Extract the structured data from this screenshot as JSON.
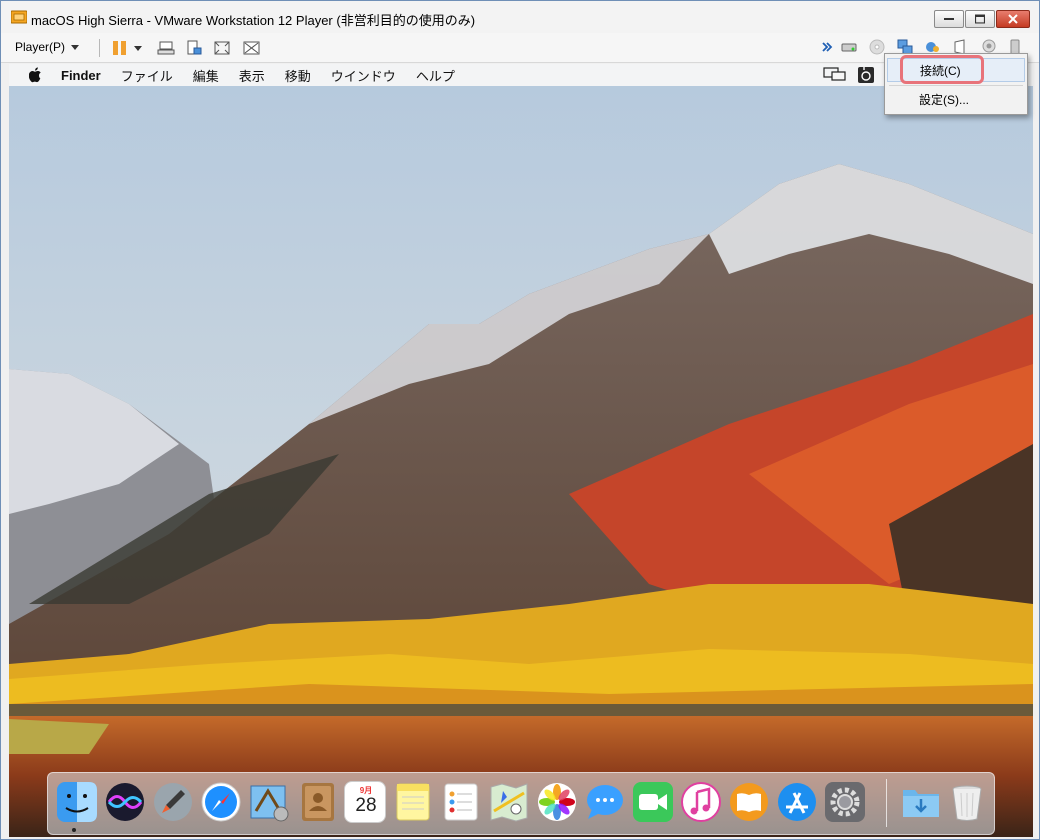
{
  "window": {
    "title": "macOS High Sierra - VMware Workstation 12 Player (非営利目的の使用のみ)",
    "controls": [
      "minimize-icon",
      "maximize-icon",
      "close-icon"
    ]
  },
  "toolbar": {
    "player_menu_label": "Player(P)",
    "icons": [
      "pause-icon",
      "chevron-down-icon",
      "send-ctrl-alt-del-icon",
      "removable-devices-icon",
      "fit-window-icon",
      "unity-icon"
    ],
    "tray_icons": [
      "double-chevron-icon",
      "hard-disk-icon",
      "cd-dvd-icon",
      "network-adapter-icon",
      "usb-controller-icon",
      "sound-card-icon",
      "printer-icon",
      "camera-icon",
      "usb-drive-icon"
    ]
  },
  "guest_menubar": {
    "apple_icon": "apple-logo-icon",
    "items": [
      "Finder",
      "ファイル",
      "編集",
      "表示",
      "移動",
      "ウインドウ",
      "ヘルプ"
    ],
    "right_icons": [
      "airplay-display-icon",
      "keyboard-icon"
    ]
  },
  "popup_menu": {
    "items": [
      {
        "label": "接続(C)",
        "highlighted": true
      },
      {
        "label": "設定(S)...",
        "highlighted": false
      }
    ]
  },
  "dock": {
    "apps": [
      "finder-icon",
      "siri-icon",
      "launchpad-icon",
      "safari-icon",
      "mail-icon",
      "contacts-icon",
      "calendar-icon",
      "notes-icon",
      "reminders-icon",
      "maps-icon",
      "photos-icon",
      "messages-icon",
      "facetime-icon",
      "itunes-icon",
      "ibooks-icon",
      "app-store-icon",
      "system-preferences-icon",
      "downloads-folder-icon",
      "trash-icon"
    ],
    "calendar_month": "9月",
    "calendar_day": "28"
  },
  "colors": {
    "highlight_ring": "#e8737a",
    "close_button": "#c43b23",
    "frame_border": "#6f8fb6"
  }
}
